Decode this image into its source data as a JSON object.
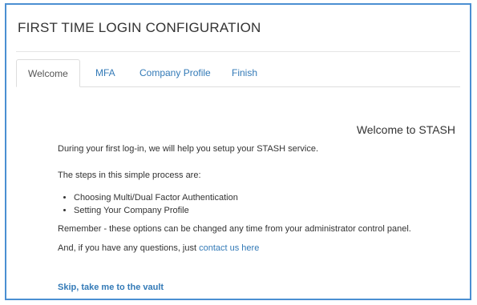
{
  "page": {
    "title": "FIRST TIME LOGIN CONFIGURATION"
  },
  "tabs": [
    {
      "label": "Welcome",
      "active": true
    },
    {
      "label": "MFA",
      "active": false
    },
    {
      "label": "Company Profile",
      "active": false
    },
    {
      "label": "Finish",
      "active": false
    }
  ],
  "content": {
    "heading": "Welcome to STASH",
    "intro": "During your first log-in, we will help you setup your STASH service.",
    "steps_intro": "The steps in this simple process are:",
    "steps": [
      "Choosing Multi/Dual Factor Authentication",
      "Setting Your Company Profile"
    ],
    "remember": "Remember - these options can be changed any time from your administrator control panel.",
    "questions_prefix": "And, if you have any questions, just ",
    "contact_link": "contact us here",
    "skip_link": "Skip, take me to the vault"
  },
  "colors": {
    "frame_border": "#4b8fd2",
    "link": "#337ab7",
    "text": "#333333"
  }
}
